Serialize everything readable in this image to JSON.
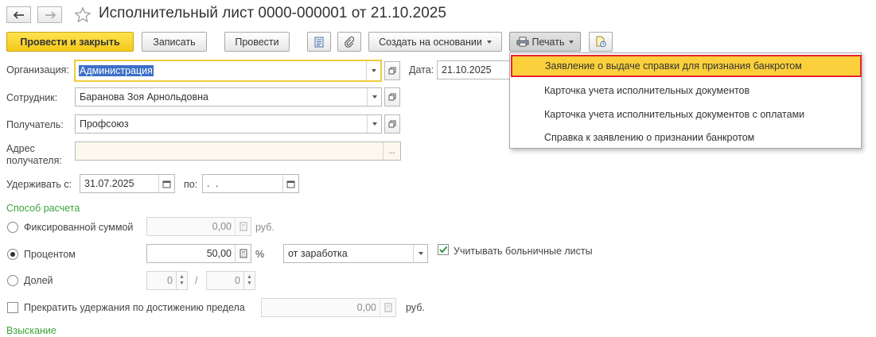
{
  "window": {
    "title": "Исполнительный лист 0000-000001 от 21.10.2025"
  },
  "toolbar": {
    "post_close": "Провести и закрыть",
    "save": "Записать",
    "post": "Провести",
    "create_based": "Создать на основании",
    "print": "Печать"
  },
  "form": {
    "organization_label": "Организация:",
    "organization_value": "Администрация",
    "date_label": "Дата:",
    "date_value": "21.10.2025",
    "employee_label": "Сотрудник:",
    "employee_value": "Баранова Зоя Арнольдовна",
    "recipient_label": "Получатель:",
    "recipient_value": "Профсоюз",
    "address_label_1": "Адрес",
    "address_label_2": "получателя:",
    "address_value": "",
    "withhold_from_label": "Удерживать с:",
    "withhold_from_value": "31.07.2025",
    "to_label": "по:",
    "to_value": " .  .",
    "calc_section": "Способ расчета",
    "fixed_label": "Фиксированной суммой",
    "fixed_value": "0,00",
    "rub": "руб.",
    "percent_label": "Процентом",
    "percent_value": "50,00",
    "percent_sign": "%",
    "percent_base": "от заработка",
    "sick_leave_label": "Учитывать больничные листы",
    "share_label": "Долей",
    "share_num": "0",
    "share_den": "0",
    "share_sep": "/",
    "stop_label": "Прекратить удержания по достижению предела",
    "stop_value": "0,00",
    "stop_rub": "руб.",
    "collection_section": "Взыскание"
  },
  "print_menu": {
    "items": [
      "Заявление о выдаче справки для признания банкротом",
      "Карточка учета исполнительных документов",
      "Карточка учета исполнительных документов с оплатами",
      "Справка к заявлению о признании банкротом"
    ]
  },
  "colors": {
    "primary": "#f5c81a",
    "section": "#3aa53a",
    "highlight": "#fbd03c",
    "highlight_border": "#e8232a"
  }
}
